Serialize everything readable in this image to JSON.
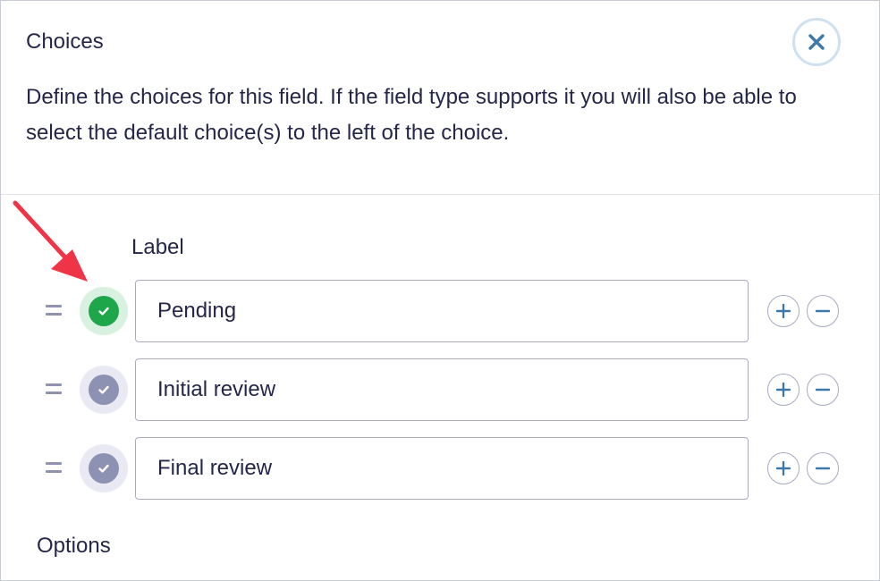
{
  "panel": {
    "title": "Choices",
    "close_icon": "close-icon",
    "description": "Define the choices for this field. If the field type supports it you will also be able to select the default choice(s) to the left of the choice."
  },
  "choices": {
    "column_label": "Label",
    "items": [
      {
        "value": "Pending",
        "is_default": true
      },
      {
        "value": "Initial review",
        "is_default": false
      },
      {
        "value": "Final review",
        "is_default": false
      }
    ]
  },
  "options": {
    "title": "Options"
  },
  "colors": {
    "accent": "#3d78a8",
    "default_on": "#1ea64a",
    "default_off": "#8e92b2",
    "annotation_arrow": "#f03447"
  }
}
